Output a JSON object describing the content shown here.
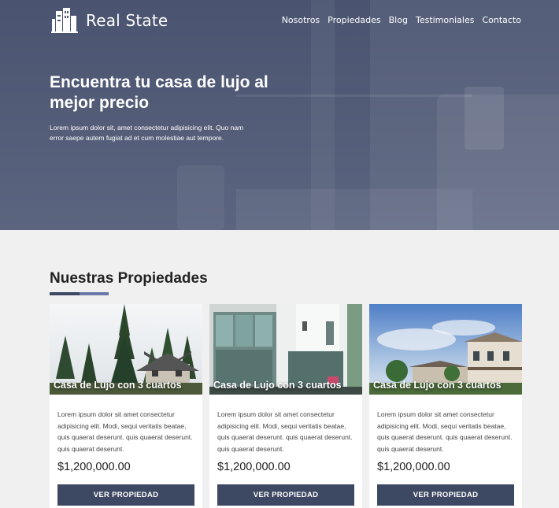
{
  "header": {
    "brand": "Real State",
    "nav": [
      "Nosotros",
      "Propiedades",
      "Blog",
      "Testimoniales",
      "Contacto"
    ]
  },
  "hero": {
    "title": "Encuentra tu casa de lujo al mejor precio",
    "text": "Lorem ipsum dolor sit, amet consectetur adipisicing elit. Quo nam error saepe autem fugiat ad et cum molestiae aut tempore."
  },
  "properties": {
    "title_prefix": "Nuestras",
    "title_bold": "Propiedades",
    "items": [
      {
        "title": "Casa de Lujo con 3 cuartos",
        "description": "Lorem ipsum dolor sit amet consectetur adipisicing elit. Modi, sequi veritatis beatae, quis quaerat deserunt. quis quaerat deserunt. quis quaerat deserunt.",
        "price": "$1,200,000.00",
        "button": "VER PROPIEDAD"
      },
      {
        "title": "Casa de Lujo con 3 cuartos",
        "description": "Lorem ipsum dolor sit amet consectetur adipisicing elit. Modi, sequi veritatis beatae, quis quaerat deserunt. quis quaerat deserunt. quis quaerat deserunt.",
        "price": "$1,200,000.00",
        "button": "VER PROPIEDAD"
      },
      {
        "title": "Casa de Lujo con 3 cuartos",
        "description": "Lorem ipsum dolor sit amet consectetur adipisicing elit. Modi, sequi veritatis beatae, quis quaerat deserunt. quis quaerat deserunt. quis quaerat deserunt.",
        "price": "$1,200,000.00",
        "button": "VER PROPIEDAD"
      }
    ]
  },
  "colors": {
    "primary": "#3d4862",
    "accent": "#6a79a8",
    "hero_overlay": "#4f5975",
    "background": "#f0f0f0"
  },
  "icons": {
    "logo": "buildings-icon"
  }
}
